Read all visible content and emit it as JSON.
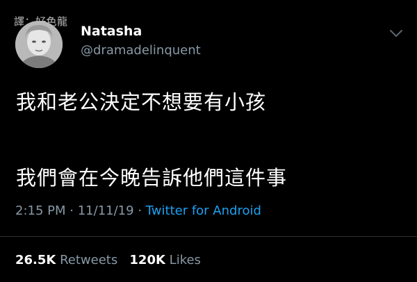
{
  "watermark": "譯：好色龍",
  "author": {
    "name": "Natasha",
    "handle": "@dramadelinquent"
  },
  "tweet": {
    "line1": "我和老公決定不想要有小孩",
    "line2": "我們會在今晚告訴他們這件事"
  },
  "meta": {
    "time": "2:15 PM",
    "date": "11/11/19",
    "separator": "·",
    "source": "Twitter for Android"
  },
  "stats": {
    "retweets_count": "26.5K",
    "retweets_label": "Retweets",
    "likes_count": "120K",
    "likes_label": "Likes"
  },
  "icons": {
    "menu": "chevron-down-icon"
  },
  "colors": {
    "background": "#000000",
    "text": "#ffffff",
    "secondary": "#8899a6",
    "link": "#1da1f2"
  }
}
